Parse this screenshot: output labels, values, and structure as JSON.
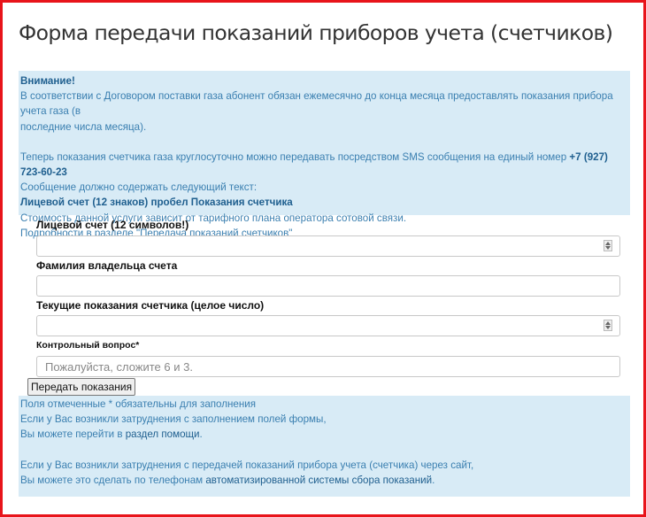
{
  "page": {
    "title": "Форма передачи показаний приборов учета (счетчиков)"
  },
  "notice": {
    "heading": "Внимание!",
    "line1": "В соответствии с Договором поставки газа абонент обязан ежемесячно до конца месяца предоставлять показания прибора учета газа (в",
    "line2": "последние числа месяца).",
    "line3_prefix": "Теперь показания счетчика газа круглосуточно можно передавать посредством SMS сообщения на единый номер ",
    "sms_number": "+7 (927) 723-60-23",
    "line4": "Сообщение должно содержать следующий текст:",
    "sms_format": "Лицевой счет (12 знаков) пробел Показания счетчика",
    "line5": "Стоимость данной услуги зависит от тарифного плана оператора сотовой связи.",
    "line6_prefix": "Подробности в разделе ",
    "details_link": "\"Передача показаний счетчиков\""
  },
  "form": {
    "account_label": "Лицевой счет (12 символов!)",
    "account_value": "",
    "owner_label": "Фамилия владельца счета",
    "owner_value": "",
    "reading_label": "Текущие показания счетчика (целое число)",
    "reading_value": "",
    "captcha_label": "Контрольный вопрос*",
    "captcha_placeholder": "Пожалуйста, сложите 6 и 3.",
    "captcha_value": "",
    "submit_label": "Передать показания"
  },
  "info": {
    "required_note": "Поля отмеченные * обязательны для заполнения",
    "help_line1": "Если у Вас возникли затруднения с заполнением полей формы,",
    "help_line2_prefix": "Вы можете перейти в ",
    "help_link": "раздел помощи",
    "help_line2_suffix": ".",
    "phone_line1": "Если у Вас возникли затруднения с передачей показаний прибора учета (счетчика) через сайт,",
    "phone_line2_prefix": "Вы можете это сделать по телефонам ",
    "phone_link": "автоматизированной системы сбора показаний",
    "phone_line2_suffix": "."
  },
  "colors": {
    "frame_border": "#e8141b",
    "panel_bg": "#d8ebf6",
    "text_blue": "#3a7fb0",
    "strong_blue": "#1f5f8f"
  }
}
